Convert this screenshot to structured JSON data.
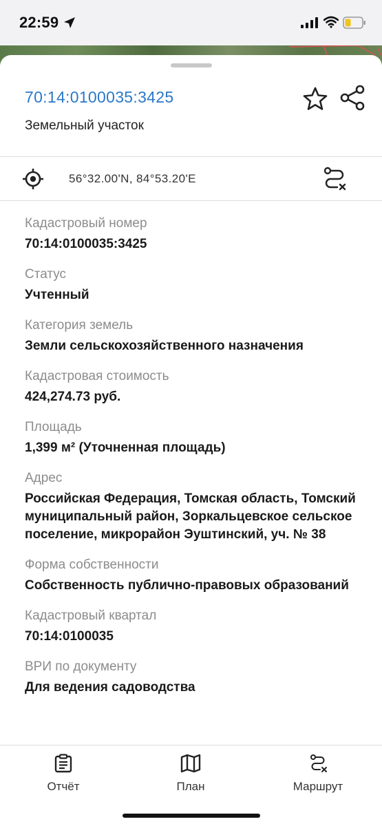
{
  "status_bar": {
    "time": "22:59"
  },
  "sheet": {
    "cadastral_id": "70:14:0100035:3425",
    "object_type": "Земельный участок",
    "coordinates": "56°32.00'N, 84°53.20'E"
  },
  "fields": [
    {
      "label": "Кадастровый номер",
      "value": "70:14:0100035:3425"
    },
    {
      "label": "Статус",
      "value": "Учтенный"
    },
    {
      "label": "Категория земель",
      "value": "Земли сельскохозяйственного назначения"
    },
    {
      "label": "Кадастровая стоимость",
      "value": "424,274.73 руб."
    },
    {
      "label": "Площадь",
      "value": "1,399 м² (Уточненная площадь)"
    },
    {
      "label": "Адрес",
      "value": "Российская Федерация, Томская область, Томский муниципальный район, Зоркальцевское сельское поселение, микрорайон Эуштинский, уч. № 38"
    },
    {
      "label": "Форма собственности",
      "value": "Собственность публично-правовых образований"
    },
    {
      "label": "Кадастровый квартал",
      "value": "70:14:0100035"
    },
    {
      "label": "ВРИ по документу",
      "value": "Для ведения садоводства"
    }
  ],
  "tabbar": {
    "report_label": "Отчёт",
    "plan_label": "План",
    "route_label": "Маршрут"
  },
  "icons": {
    "favorite": "star-icon",
    "share": "share-icon",
    "location": "target-icon",
    "route": "route-icon",
    "report": "clipboard-icon",
    "plan": "map-icon"
  },
  "colors": {
    "link": "#2a78c8",
    "label": "#8c8c8c",
    "value": "#1a1a1a"
  }
}
